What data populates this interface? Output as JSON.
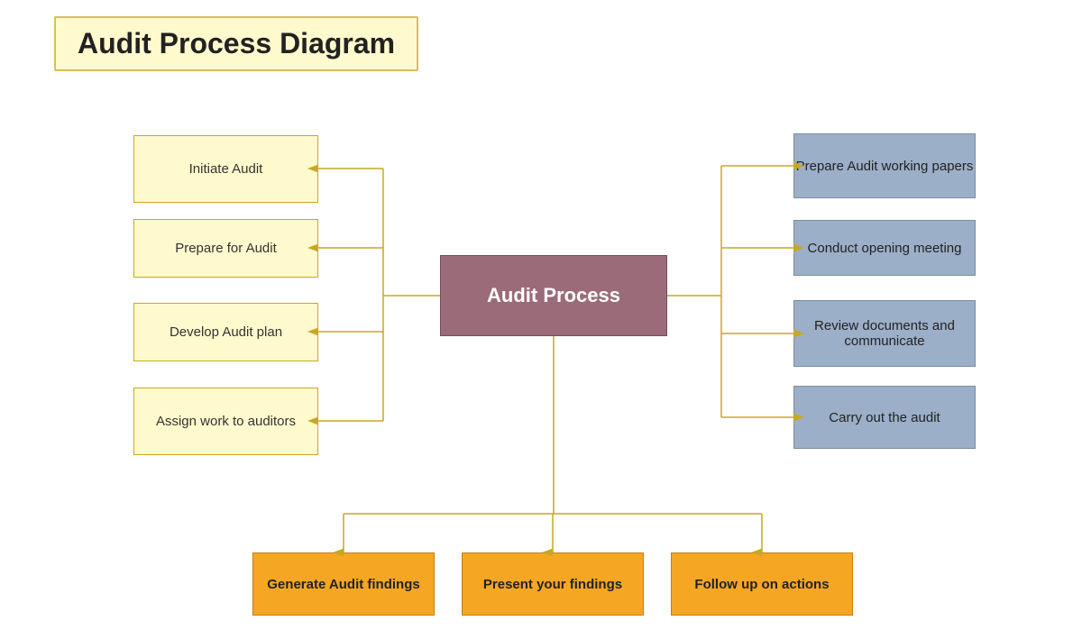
{
  "title": "Audit Process Diagram",
  "center": "Audit Process",
  "leftBoxes": [
    {
      "id": "initiate",
      "label": "Initiate Audit"
    },
    {
      "id": "prepare",
      "label": "Prepare for Audit"
    },
    {
      "id": "develop",
      "label": "Develop Audit plan"
    },
    {
      "id": "assign",
      "label": "Assign work to auditors"
    }
  ],
  "rightBoxes": [
    {
      "id": "papers",
      "label": "Prepare Audit working papers"
    },
    {
      "id": "meeting",
      "label": "Conduct opening meeting"
    },
    {
      "id": "review",
      "label": "Review documents and communicate"
    },
    {
      "id": "carryout",
      "label": "Carry out the audit"
    }
  ],
  "bottomBoxes": [
    {
      "id": "generate",
      "label": "Generate Audit findings"
    },
    {
      "id": "present",
      "label": "Present your findings"
    },
    {
      "id": "followup",
      "label": "Follow up on actions"
    }
  ],
  "colors": {
    "leftBg": "#fffacd",
    "leftBorder": "#c8a820",
    "rightBg": "#9bafc8",
    "rightBorder": "#7a8fa0",
    "bottomBg": "#f5a623",
    "bottomBorder": "#c87d10",
    "centerBg": "#9b6b7a",
    "centerBorder": "#7a4a5a",
    "titleBg": "#fffacd",
    "lineColor": "#c8a820"
  }
}
